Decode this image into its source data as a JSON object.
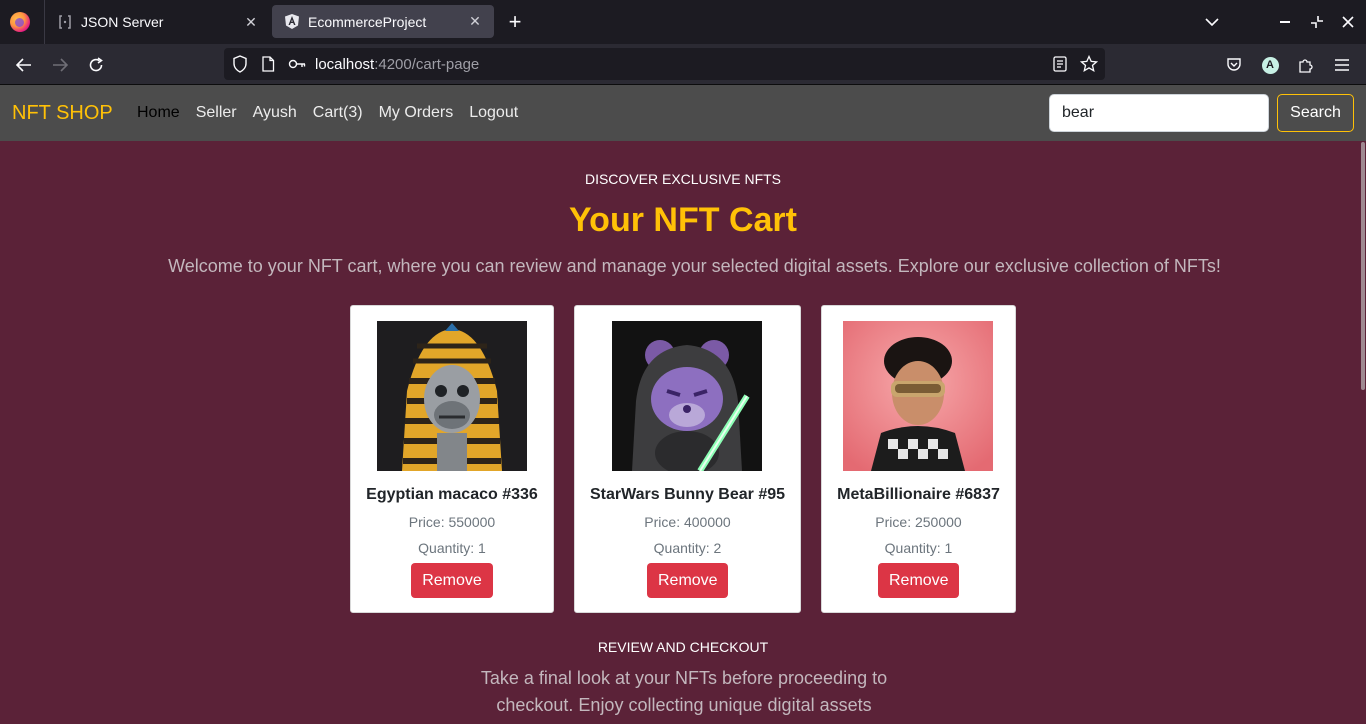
{
  "browser": {
    "tabs": [
      {
        "title": "JSON Server",
        "icon": "json-server-icon"
      },
      {
        "title": "EcommerceProject",
        "icon": "angular-icon"
      }
    ],
    "url_host": "localhost",
    "url_rest": ":4200/cart-page",
    "account_initial": "A"
  },
  "nav": {
    "brand": "NFT SHOP",
    "links": [
      "Home",
      "Seller",
      "Ayush",
      "Cart(3)",
      "My Orders",
      "Logout"
    ],
    "search_value": "bear",
    "search_button": "Search"
  },
  "colors": {
    "accent": "#ffc107",
    "page_bg": "#5b2238",
    "danger": "#dc3545",
    "nav_bg": "#4c4c4c"
  },
  "hero": {
    "eyebrow": "DISCOVER EXCLUSIVE NFTS",
    "title": "Your NFT Cart",
    "lead": "Welcome to your NFT cart, where you can review and manage your selected digital assets. Explore our exclusive collection of NFTs!"
  },
  "cart": [
    {
      "name": "Egyptian macaco #336",
      "price": "Price: 550000",
      "quantity": "Quantity: 1",
      "remove": "Remove"
    },
    {
      "name": "StarWars Bunny Bear #95",
      "price": "Price: 400000",
      "quantity": "Quantity: 2",
      "remove": "Remove"
    },
    {
      "name": "MetaBillionaire #6837",
      "price": "Price: 250000",
      "quantity": "Quantity: 1",
      "remove": "Remove"
    }
  ],
  "footer": {
    "eyebrow": "REVIEW AND CHECKOUT",
    "text": "Take a final look at your NFTs before proceeding to checkout. Enjoy collecting unique digital assets with us!"
  }
}
